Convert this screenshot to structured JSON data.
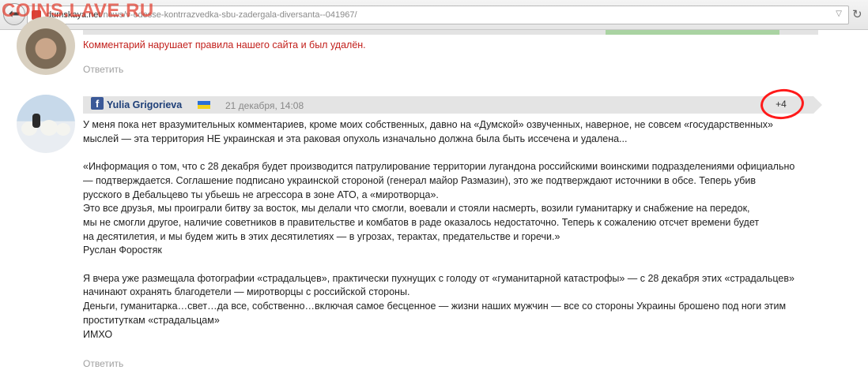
{
  "browser": {
    "url_host": "dumskaya.net",
    "url_path": "/news/v-odesse-kontrrazvedka-sbu-zadergala-diversanta--041967/",
    "watermark": "COINS.LAVE.RU",
    "back_glyph": "⬅",
    "reload_glyph": "↻",
    "dropdown_glyph": "▽"
  },
  "comments": {
    "deleted": {
      "message": "Комментарий нарушает правила нашего сайта и был удалён.",
      "reply_label": "Ответить"
    },
    "main": {
      "social_glyph": "f",
      "author": "Yulia Grigorieva",
      "date": "21 декабря, 14:08",
      "rating": "+4",
      "reply_label": "Ответить",
      "paragraphs": [
        "У меня пока нет вразумительных комментариев, кроме моих собственных, давно на «Думской» озвученных, наверное, не совсем «государственных»\nмыслей — эта территория НЕ украинская и эта раковая опухоль изначально должна была быть иссечена и удалена...",
        "«Информация о том, что с 28 декабря будет производится патрулирование территории лугандона российскими воинскими подразделениями официально\n— подтверждается. Соглашение подписано украинской стороной (генерал майор Размазин), это же подтверждают источники в обсе. Теперь убив\nрусского в Дебальцево ты убьешь не агрессора в зоне АТО, а «миротворца».\nЭто все друзья, мы проиграли битву за восток, мы делали что смогли, воевали и стояли насмерть, возили гуманитарку и снабжение на передок,\nмы не смогли другое, наличие советников в правительстве и комбатов в раде оказалось недостаточно. Теперь к сожалению отсчет времени будет\nна десятилетия, и мы будем жить в этих десятилетиях — в угрозах, терактах, предательстве и горечи.»\nРуслан Форостяк",
        "Я вчера уже размещала фотографии «страдальцев», практически пухнущих с голоду от «гуманитарной катастрофы» — с 28 декабря этих «страдальцев»\nначинают охранять благодетели — миротворцы с российской стороны.\nДеньги, гуманитарка…свет…да все, собственно…включая самое бесценное — жизни наших мужчин — все со стороны Украины брошено под ноги этим\nпроституткам «страдальцам»\nИМХО"
      ]
    }
  },
  "colors": {
    "deleted_text": "#c2201c",
    "author_link": "#1e3f78",
    "facebook": "#3b5998",
    "highlight_circle": "#ff1a1a",
    "header_bar": "#e4e4e4"
  }
}
